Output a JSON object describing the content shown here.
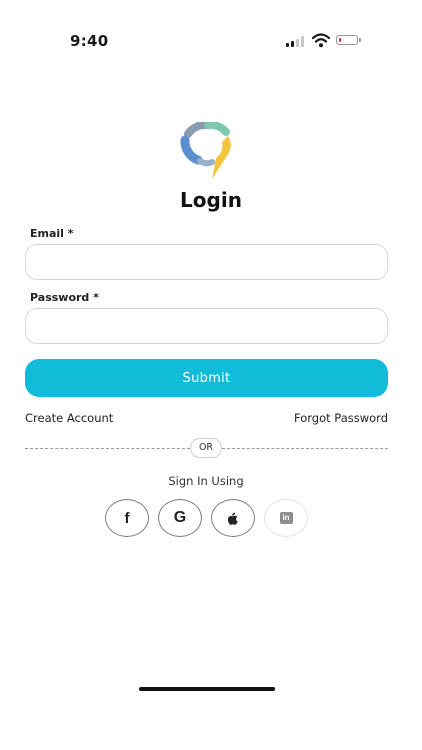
{
  "status_bar": {
    "time": "9:40",
    "signal_bars_filled": 2,
    "signal_bars_total": 4,
    "battery_level": 0.15,
    "battery_color": "#e0262b"
  },
  "brand": {
    "logo_icon": "location-pin-logo-icon",
    "logo_colors": [
      "#5b8fd0",
      "#7fc8b0",
      "#f2c53d",
      "#8a9bb0"
    ]
  },
  "form": {
    "title": "Login",
    "email_label": "Email *",
    "email_value": "",
    "email_placeholder": "",
    "password_label": "Password *",
    "password_value": "",
    "password_placeholder": "",
    "submit_label": "Submit",
    "submit_color": "#10bcd8"
  },
  "links": {
    "create_account": "Create Account",
    "forgot_password": "Forgot Password"
  },
  "divider": {
    "text": "OR"
  },
  "social": {
    "heading": "Sign In Using",
    "buttons": [
      {
        "icon": "facebook-icon",
        "glyph": "f"
      },
      {
        "icon": "google-icon",
        "glyph": "G"
      },
      {
        "icon": "apple-icon",
        "glyph": ""
      },
      {
        "icon": "linkedin-icon",
        "glyph": "in"
      }
    ]
  }
}
